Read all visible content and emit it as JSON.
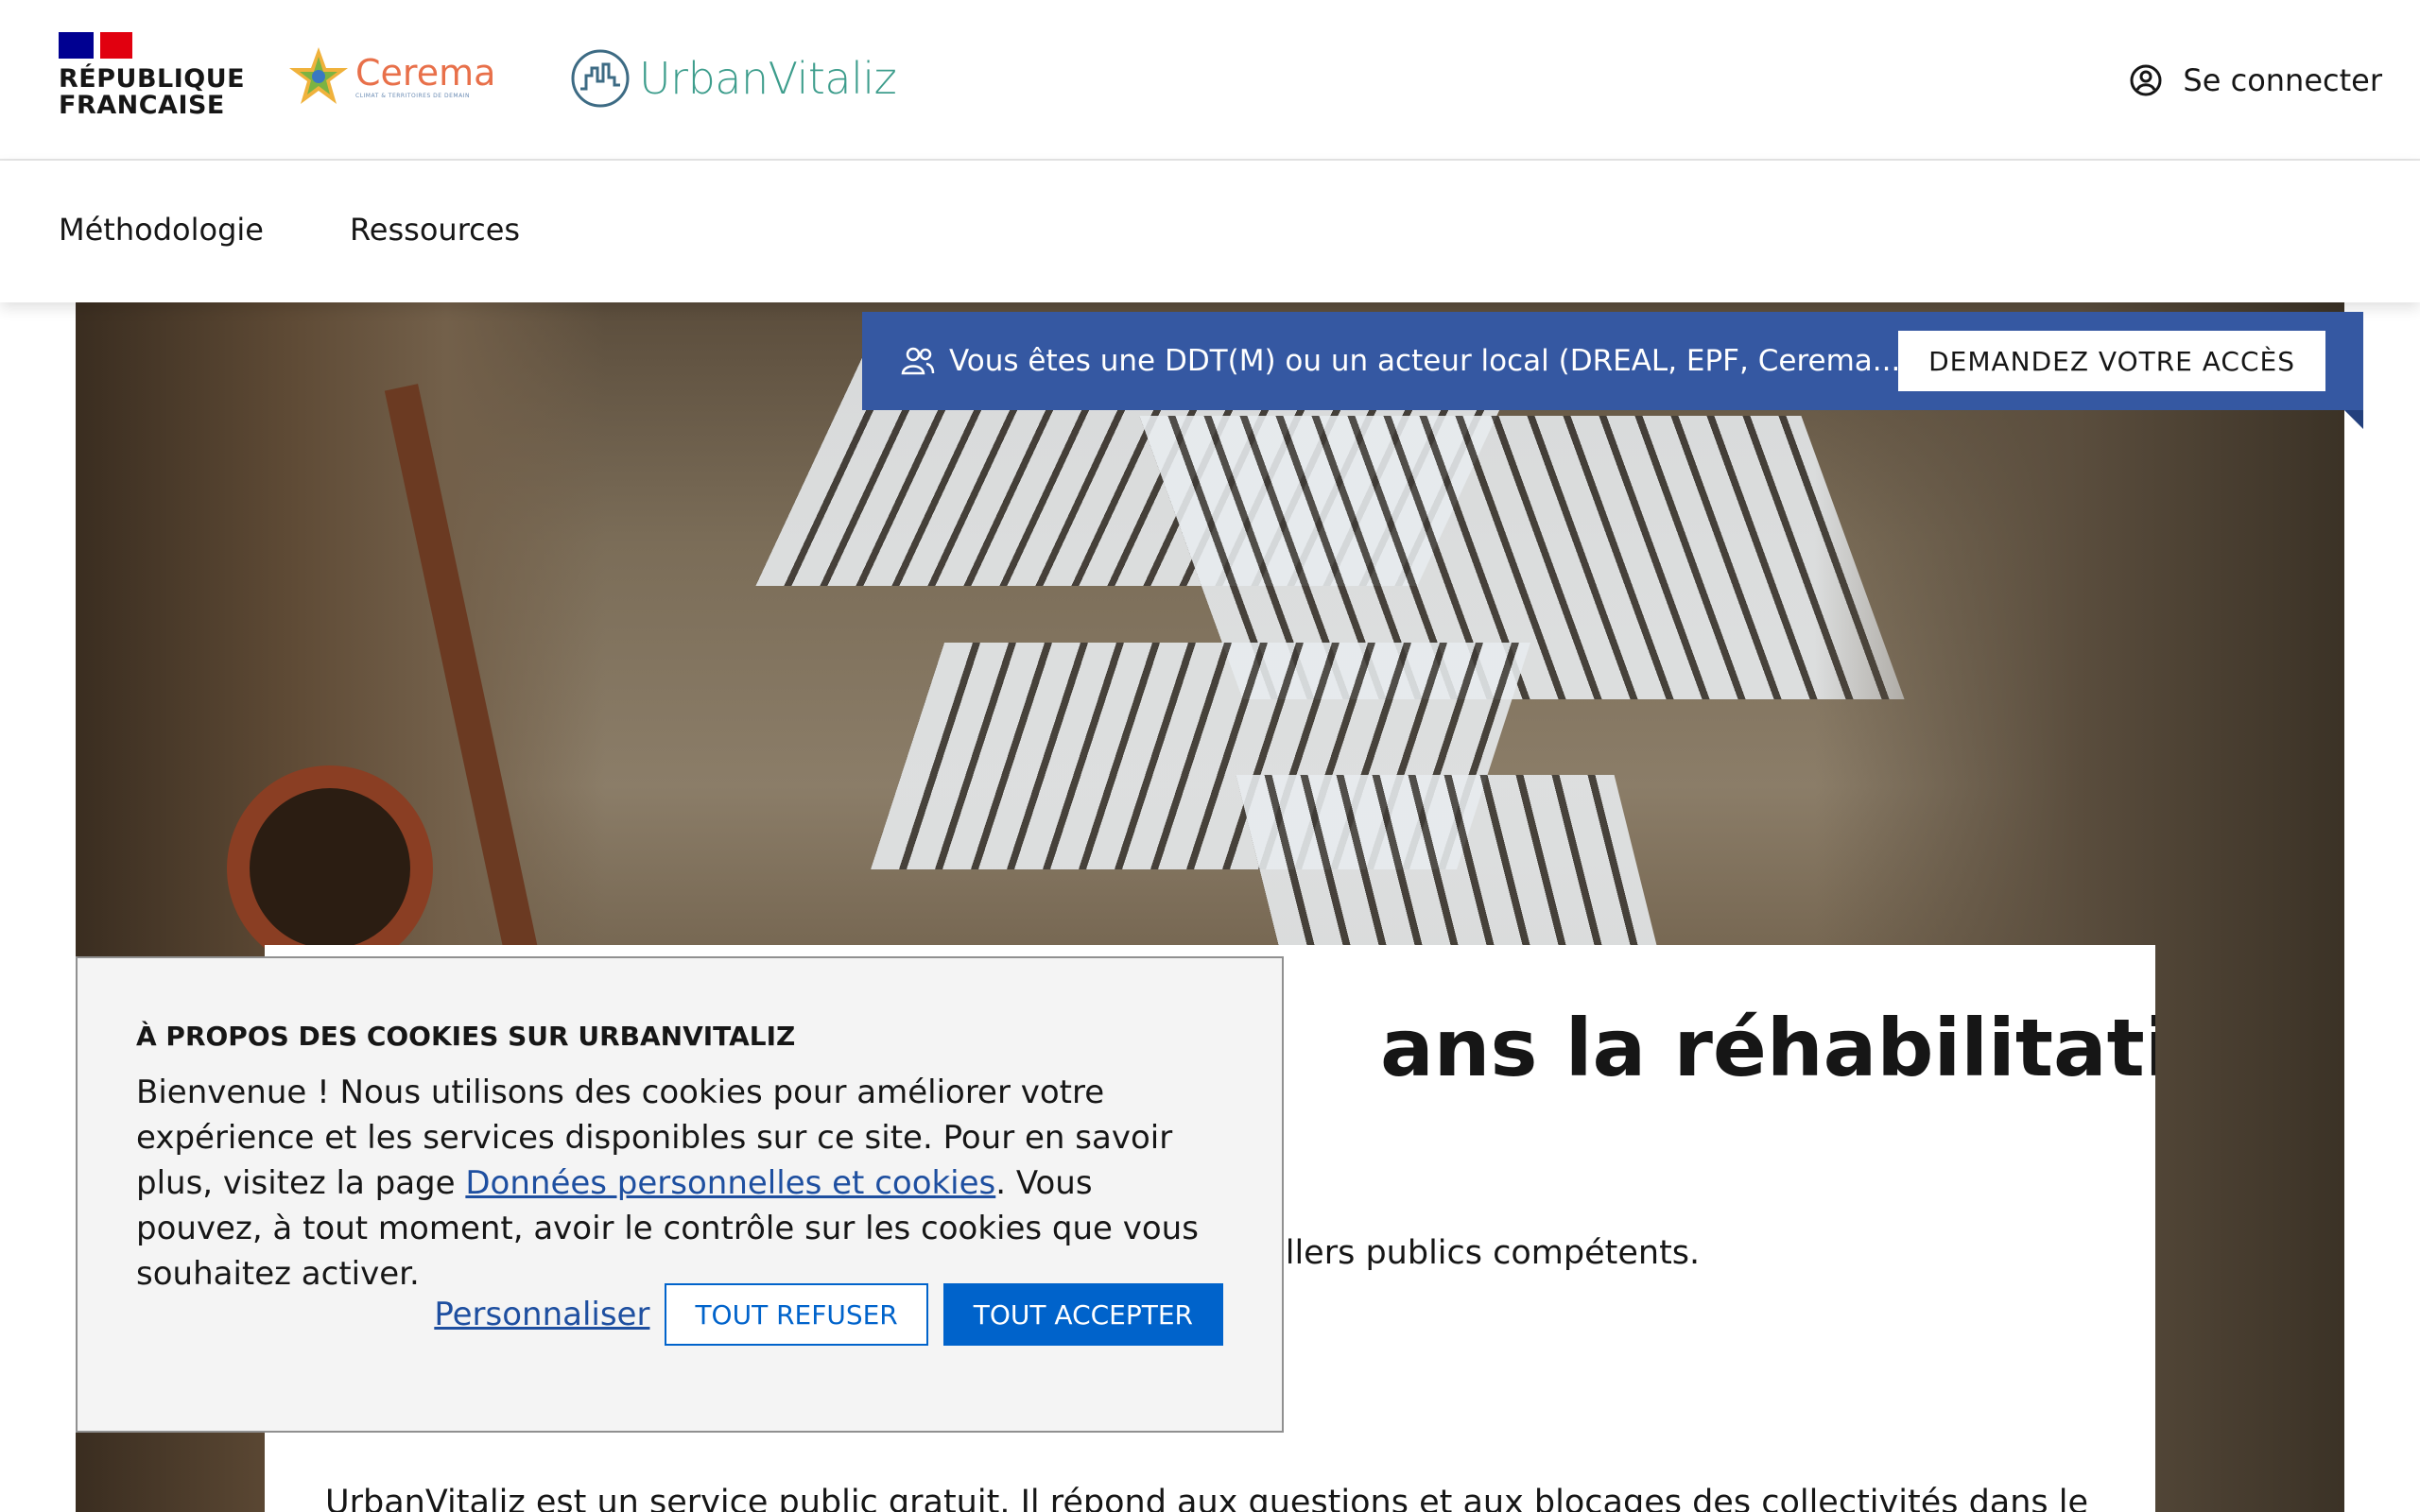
{
  "header": {
    "republique_line1": "RÉPUBLIQUE",
    "republique_line2": "FRANCAISE",
    "cerema_name": "Cerema",
    "cerema_tagline": "CLIMAT & TERRITOIRES DE DEMAIN",
    "app_name": "UrbanVitaliz",
    "login_label": "Se connecter",
    "login_icon": "user-circle-icon"
  },
  "nav": {
    "items": [
      {
        "label": "Méthodologie"
      },
      {
        "label": "Ressources"
      }
    ]
  },
  "access_banner": {
    "icon": "users-icon",
    "text": "Vous êtes une DDT(M) ou un acteur local (DREAL, EPF, Cerema...) ?",
    "button_label": "DEMANDEZ VOTRE ACCÈS"
  },
  "hero_card": {
    "title_visible": "ans la réhabilitation",
    "lead_visible": "illers publics compétents.",
    "body_visible": "UrbanVitaliz est un service public gratuit. Il répond aux questions et aux blocages des collectivités dans le"
  },
  "cookie_banner": {
    "title": "À PROPOS DES COOKIES SUR URBANVITALIZ",
    "text_part1": "Bienvenue ! Nous utilisons des cookies pour améliorer votre expérience et les services disponibles sur ce site. Pour en savoir plus, visitez la page ",
    "link_label": "Données personnelles et cookies",
    "text_part2": ". Vous pouvez, à tout moment, avoir le contrôle sur les cookies que vous souhaitez activer.",
    "customize_label": "Personnaliser",
    "refuse_label": "TOUT REFUSER",
    "accept_label": "TOUT ACCEPTER"
  },
  "colors": {
    "banner_blue": "#3558a2",
    "primary_blue": "#0063cb",
    "link_blue": "#1e4fa0",
    "urbanvitaliz_green": "#3d9d8c",
    "cerema_orange": "#e8704a"
  }
}
